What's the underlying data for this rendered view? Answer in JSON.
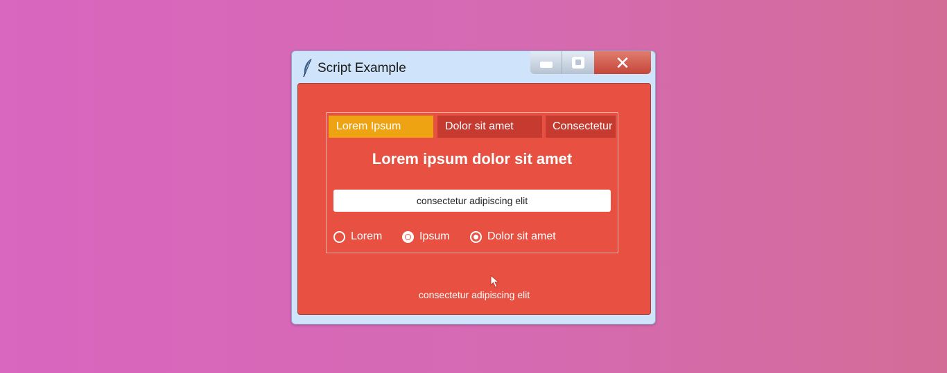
{
  "window": {
    "title": "Script Example",
    "icon": "feather-icon",
    "controls": {
      "minimize": "minimize-icon",
      "maximize": "maximize-icon",
      "close_glyph": "✕"
    }
  },
  "tabs": [
    {
      "label": "Lorem Ipsum",
      "active": true
    },
    {
      "label": "Dolor sit amet",
      "active": false
    },
    {
      "label": "Consectetur",
      "active": false
    }
  ],
  "headline": "Lorem ipsum dolor sit amet",
  "entry": {
    "value": "consectetur adipiscing elit"
  },
  "radios": [
    {
      "label": "Lorem",
      "state": "unselected"
    },
    {
      "label": "Ipsum",
      "state": "selected"
    },
    {
      "label": "Dolor sit amet",
      "state": "hover"
    }
  ],
  "footer": "consectetur adipiscing elit",
  "colors": {
    "background": "#d966bf",
    "titlebar": "#cfe3fa",
    "content": "#e85142",
    "tab_active": "#eea412",
    "tab_inactive": "#c63a2f",
    "close_button": "#c4463a"
  }
}
